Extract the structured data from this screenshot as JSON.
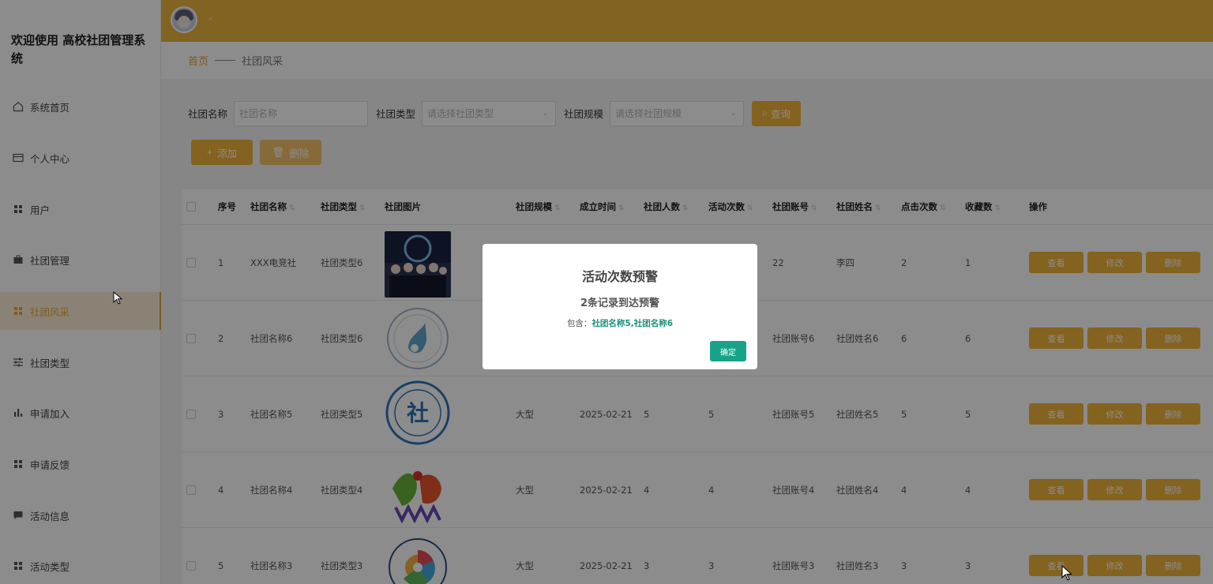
{
  "sidebar": {
    "brand": "欢迎使用 高校社团管理系统",
    "items": [
      {
        "label": "系统首页",
        "icon": "home-icon"
      },
      {
        "label": "个人中心",
        "icon": "card-icon"
      },
      {
        "label": "用户",
        "icon": "grid-icon"
      },
      {
        "label": "社团管理",
        "icon": "briefcase-icon"
      },
      {
        "label": "社团风采",
        "icon": "grid-icon",
        "active": true
      },
      {
        "label": "社团类型",
        "icon": "sliders-icon"
      },
      {
        "label": "申请加入",
        "icon": "bar-chart-icon"
      },
      {
        "label": "申请反馈",
        "icon": "grid-icon"
      },
      {
        "label": "活动信息",
        "icon": "message-icon"
      },
      {
        "label": "活动类型",
        "icon": "grid-icon"
      }
    ]
  },
  "topbar": {
    "close_glyph": "×"
  },
  "breadcrumb": {
    "home": "首页",
    "current": "社团风采"
  },
  "search": {
    "name_label": "社团名称",
    "name_placeholder": "社团名称",
    "type_label": "社团类型",
    "type_placeholder": "请选择社团类型",
    "scale_label": "社团规模",
    "scale_placeholder": "请选择社团规模",
    "query_button": "查询"
  },
  "toolbar": {
    "add_button": "添加",
    "delete_button": "删除"
  },
  "table": {
    "columns": [
      "序号",
      "社团名称",
      "社团类型",
      "社团图片",
      "社团规模",
      "成立时间",
      "社团人数",
      "活动次数",
      "社团账号",
      "社团姓名",
      "点击次数",
      "收藏数",
      "操作"
    ],
    "rows": [
      {
        "no": "1",
        "name": "XXX电竞社",
        "type": "社团类型6",
        "scale": "",
        "date": "",
        "members": "",
        "activities": "",
        "account": "22",
        "person": "李四",
        "clicks": "2",
        "favorites": "1"
      },
      {
        "no": "2",
        "name": "社团名称6",
        "type": "社团类型6",
        "scale": "",
        "date": "",
        "members": "",
        "activities": "",
        "account": "社团账号6",
        "person": "社团姓名6",
        "clicks": "6",
        "favorites": "6"
      },
      {
        "no": "3",
        "name": "社团名称5",
        "type": "社团类型5",
        "scale": "大型",
        "date": "2025-02-21",
        "members": "5",
        "activities": "5",
        "account": "社团账号5",
        "person": "社团姓名5",
        "clicks": "5",
        "favorites": "5"
      },
      {
        "no": "4",
        "name": "社团名称4",
        "type": "社团类型4",
        "scale": "大型",
        "date": "2025-02-21",
        "members": "4",
        "activities": "4",
        "account": "社团账号4",
        "person": "社团姓名4",
        "clicks": "4",
        "favorites": "4"
      },
      {
        "no": "5",
        "name": "社团名称3",
        "type": "社团类型3",
        "scale": "大型",
        "date": "2025-02-21",
        "members": "3",
        "activities": "3",
        "account": "社团账号3",
        "person": "社团姓名3",
        "clicks": "3",
        "favorites": "3"
      }
    ],
    "ops": {
      "view": "查看",
      "edit": "修改",
      "delete": "删除"
    },
    "logo_text": "社"
  },
  "modal": {
    "title": "活动次数预警",
    "message": "2条记录到达预警",
    "detail_prefix": "包含：",
    "detail_items": "社团名称5,社团名称6",
    "ok_button": "确定"
  },
  "colors": {
    "accent": "#ecb43e",
    "button": "#f0b23a",
    "ok": "#17a388",
    "active_text": "#e9a83b"
  }
}
